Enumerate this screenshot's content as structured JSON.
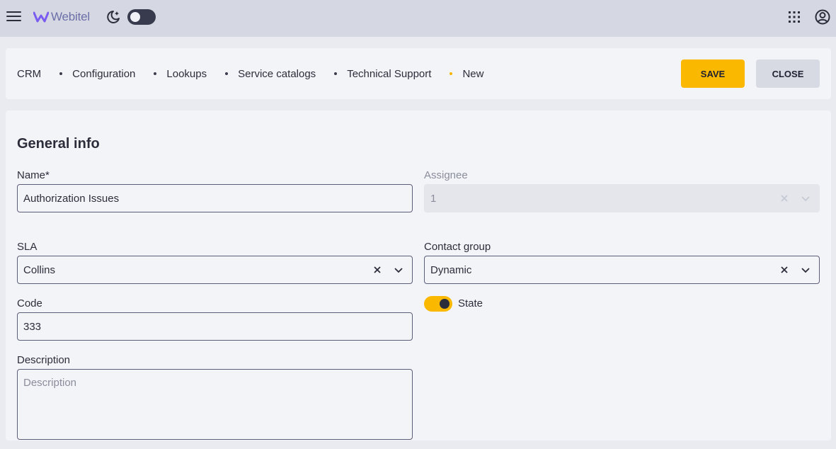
{
  "appbar": {
    "logo_text": "Webitel",
    "menu_icon": "hamburger-icon",
    "theme_icon": "moon-icon",
    "apps_icon": "apps-grid-icon",
    "account_icon": "account-circle-icon"
  },
  "breadcrumb": {
    "items": [
      "CRM",
      "Configuration",
      "Lookups",
      "Service catalogs",
      "Technical Support",
      "New"
    ],
    "active_dot_color": "#f7b500"
  },
  "actions": {
    "save_label": "SAVE",
    "close_label": "CLOSE",
    "save_color": "#fbb800"
  },
  "form": {
    "title": "General info",
    "name": {
      "label": "Name*",
      "value": "Authorization Issues"
    },
    "assignee": {
      "label": "Assignee",
      "value": "1",
      "disabled": true
    },
    "sla": {
      "label": "SLA",
      "value": "Collins"
    },
    "contact_group": {
      "label": "Contact group",
      "value": "Dynamic"
    },
    "code": {
      "label": "Code",
      "value": "333"
    },
    "state": {
      "label": "State",
      "on": true
    },
    "description": {
      "label": "Description",
      "placeholder": "Description"
    }
  }
}
